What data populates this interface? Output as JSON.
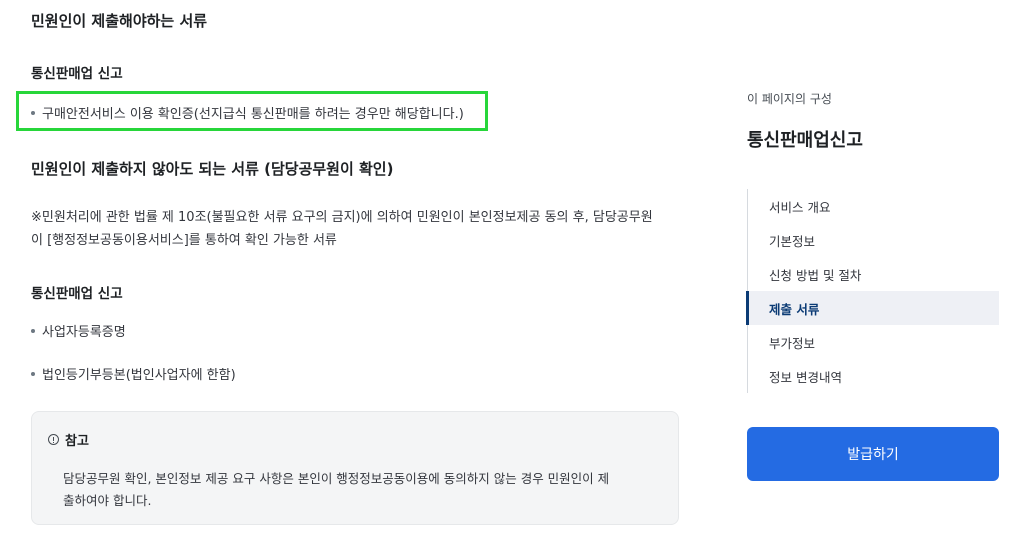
{
  "main": {
    "required_title": "민원인이 제출해야하는 서류",
    "required_subtitle": "통신판매업 신고",
    "required_items": [
      "구매안전서비스 이용 확인증(선지급식 통신판매를 하려는 경우만 해당합니다.)"
    ],
    "not_required_title": "민원인이 제출하지 않아도 되는 서류 (담당공무원이 확인)",
    "not_required_desc_line1": "※민원처리에 관한 법률 제 10조(불필요한 서류 요구의 금지)에 의하여 민원인이 본인정보제공 동의 후, 담당공무원",
    "not_required_desc_line2": "이 [행정정보공동이용서비스]를 통하여 확인 가능한 서류",
    "not_required_subtitle": "통신판매업 신고",
    "not_required_items": [
      "사업자등록증명",
      "법인등기부등본(법인사업자에 한함)"
    ],
    "note": {
      "icon": "info-circle-icon",
      "title": "참고",
      "text_line1": "담당공무원 확인, 본인정보 제공 요구 사항은 본인이 행정정보공동이용에 동의하지 않는 경우 민원인이 제",
      "text_line2": "출하여야 합니다."
    }
  },
  "sidebar": {
    "caption": "이 페이지의 구성",
    "title": "통신판매업신고",
    "nav": [
      {
        "label": "서비스 개요",
        "active": false
      },
      {
        "label": "기본정보",
        "active": false
      },
      {
        "label": "신청 방법 및 절차",
        "active": false
      },
      {
        "label": "제출 서류",
        "active": true
      },
      {
        "label": "부가정보",
        "active": false
      },
      {
        "label": "정보 변경내역",
        "active": false
      }
    ],
    "issue_button": "발급하기"
  },
  "colors": {
    "highlight": "#27d63a",
    "primary_button": "#246be3",
    "active_nav": "#0b3b75"
  }
}
